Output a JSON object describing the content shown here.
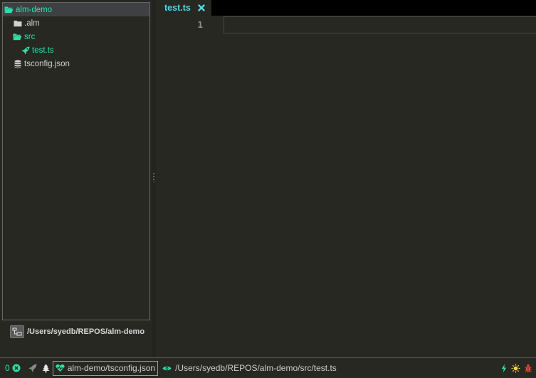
{
  "tree": {
    "items": [
      {
        "label": "alm-demo",
        "icon": "folder-open-icon",
        "color": "#2ee0a8"
      },
      {
        "label": ".alm",
        "icon": "folder-icon",
        "color": "#d0d0d0"
      },
      {
        "label": "src",
        "icon": "folder-open-icon",
        "color": "#2ee0a8"
      },
      {
        "label": "test.ts",
        "icon": "rocket-icon",
        "color": "#2ee0a8"
      },
      {
        "label": "tsconfig.json",
        "icon": "database-icon",
        "color": "#d0d0d0"
      }
    ],
    "project_root_label": "/Users/syedb/REPOS/alm-demo"
  },
  "tabs": [
    {
      "title": "test.ts",
      "active": true,
      "close_icon": "close-icon"
    }
  ],
  "editor": {
    "line_numbers": [
      "1"
    ],
    "lines": [
      ""
    ]
  },
  "status": {
    "error_count": "0",
    "active_project": "alm-demo/tsconfig.json",
    "open_file_path": "/Users/syedb/REPOS/alm-demo/src/test.ts",
    "icons": [
      "close-circle-icon",
      "rocket-icon",
      "tree-icon",
      "heartbeat-icon",
      "eye-icon",
      "bolt-icon",
      "sun-icon",
      "bug-icon"
    ]
  },
  "colors": {
    "accent": "#2ee0a8",
    "tab_accent": "#4fd8ea",
    "background": "#272822"
  }
}
